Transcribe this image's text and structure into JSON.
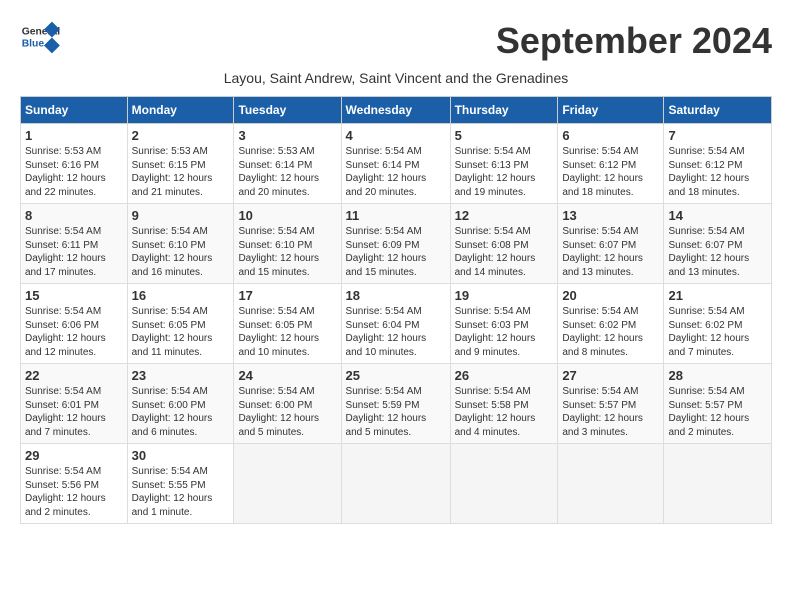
{
  "header": {
    "logo_general": "General",
    "logo_blue": "Blue",
    "title": "September 2024",
    "subtitle": "Layou, Saint Andrew, Saint Vincent and the Grenadines"
  },
  "columns": [
    "Sunday",
    "Monday",
    "Tuesday",
    "Wednesday",
    "Thursday",
    "Friday",
    "Saturday"
  ],
  "weeks": [
    [
      {
        "day": "1",
        "info": "Sunrise: 5:53 AM\nSunset: 6:16 PM\nDaylight: 12 hours\nand 22 minutes."
      },
      {
        "day": "2",
        "info": "Sunrise: 5:53 AM\nSunset: 6:15 PM\nDaylight: 12 hours\nand 21 minutes."
      },
      {
        "day": "3",
        "info": "Sunrise: 5:53 AM\nSunset: 6:14 PM\nDaylight: 12 hours\nand 20 minutes."
      },
      {
        "day": "4",
        "info": "Sunrise: 5:54 AM\nSunset: 6:14 PM\nDaylight: 12 hours\nand 20 minutes."
      },
      {
        "day": "5",
        "info": "Sunrise: 5:54 AM\nSunset: 6:13 PM\nDaylight: 12 hours\nand 19 minutes."
      },
      {
        "day": "6",
        "info": "Sunrise: 5:54 AM\nSunset: 6:12 PM\nDaylight: 12 hours\nand 18 minutes."
      },
      {
        "day": "7",
        "info": "Sunrise: 5:54 AM\nSunset: 6:12 PM\nDaylight: 12 hours\nand 18 minutes."
      }
    ],
    [
      {
        "day": "8",
        "info": "Sunrise: 5:54 AM\nSunset: 6:11 PM\nDaylight: 12 hours\nand 17 minutes."
      },
      {
        "day": "9",
        "info": "Sunrise: 5:54 AM\nSunset: 6:10 PM\nDaylight: 12 hours\nand 16 minutes."
      },
      {
        "day": "10",
        "info": "Sunrise: 5:54 AM\nSunset: 6:10 PM\nDaylight: 12 hours\nand 15 minutes."
      },
      {
        "day": "11",
        "info": "Sunrise: 5:54 AM\nSunset: 6:09 PM\nDaylight: 12 hours\nand 15 minutes."
      },
      {
        "day": "12",
        "info": "Sunrise: 5:54 AM\nSunset: 6:08 PM\nDaylight: 12 hours\nand 14 minutes."
      },
      {
        "day": "13",
        "info": "Sunrise: 5:54 AM\nSunset: 6:07 PM\nDaylight: 12 hours\nand 13 minutes."
      },
      {
        "day": "14",
        "info": "Sunrise: 5:54 AM\nSunset: 6:07 PM\nDaylight: 12 hours\nand 13 minutes."
      }
    ],
    [
      {
        "day": "15",
        "info": "Sunrise: 5:54 AM\nSunset: 6:06 PM\nDaylight: 12 hours\nand 12 minutes."
      },
      {
        "day": "16",
        "info": "Sunrise: 5:54 AM\nSunset: 6:05 PM\nDaylight: 12 hours\nand 11 minutes."
      },
      {
        "day": "17",
        "info": "Sunrise: 5:54 AM\nSunset: 6:05 PM\nDaylight: 12 hours\nand 10 minutes."
      },
      {
        "day": "18",
        "info": "Sunrise: 5:54 AM\nSunset: 6:04 PM\nDaylight: 12 hours\nand 10 minutes."
      },
      {
        "day": "19",
        "info": "Sunrise: 5:54 AM\nSunset: 6:03 PM\nDaylight: 12 hours\nand 9 minutes."
      },
      {
        "day": "20",
        "info": "Sunrise: 5:54 AM\nSunset: 6:02 PM\nDaylight: 12 hours\nand 8 minutes."
      },
      {
        "day": "21",
        "info": "Sunrise: 5:54 AM\nSunset: 6:02 PM\nDaylight: 12 hours\nand 7 minutes."
      }
    ],
    [
      {
        "day": "22",
        "info": "Sunrise: 5:54 AM\nSunset: 6:01 PM\nDaylight: 12 hours\nand 7 minutes."
      },
      {
        "day": "23",
        "info": "Sunrise: 5:54 AM\nSunset: 6:00 PM\nDaylight: 12 hours\nand 6 minutes."
      },
      {
        "day": "24",
        "info": "Sunrise: 5:54 AM\nSunset: 6:00 PM\nDaylight: 12 hours\nand 5 minutes."
      },
      {
        "day": "25",
        "info": "Sunrise: 5:54 AM\nSunset: 5:59 PM\nDaylight: 12 hours\nand 5 minutes."
      },
      {
        "day": "26",
        "info": "Sunrise: 5:54 AM\nSunset: 5:58 PM\nDaylight: 12 hours\nand 4 minutes."
      },
      {
        "day": "27",
        "info": "Sunrise: 5:54 AM\nSunset: 5:57 PM\nDaylight: 12 hours\nand 3 minutes."
      },
      {
        "day": "28",
        "info": "Sunrise: 5:54 AM\nSunset: 5:57 PM\nDaylight: 12 hours\nand 2 minutes."
      }
    ],
    [
      {
        "day": "29",
        "info": "Sunrise: 5:54 AM\nSunset: 5:56 PM\nDaylight: 12 hours\nand 2 minutes."
      },
      {
        "day": "30",
        "info": "Sunrise: 5:54 AM\nSunset: 5:55 PM\nDaylight: 12 hours\nand 1 minute."
      },
      {
        "day": "",
        "info": ""
      },
      {
        "day": "",
        "info": ""
      },
      {
        "day": "",
        "info": ""
      },
      {
        "day": "",
        "info": ""
      },
      {
        "day": "",
        "info": ""
      }
    ]
  ]
}
